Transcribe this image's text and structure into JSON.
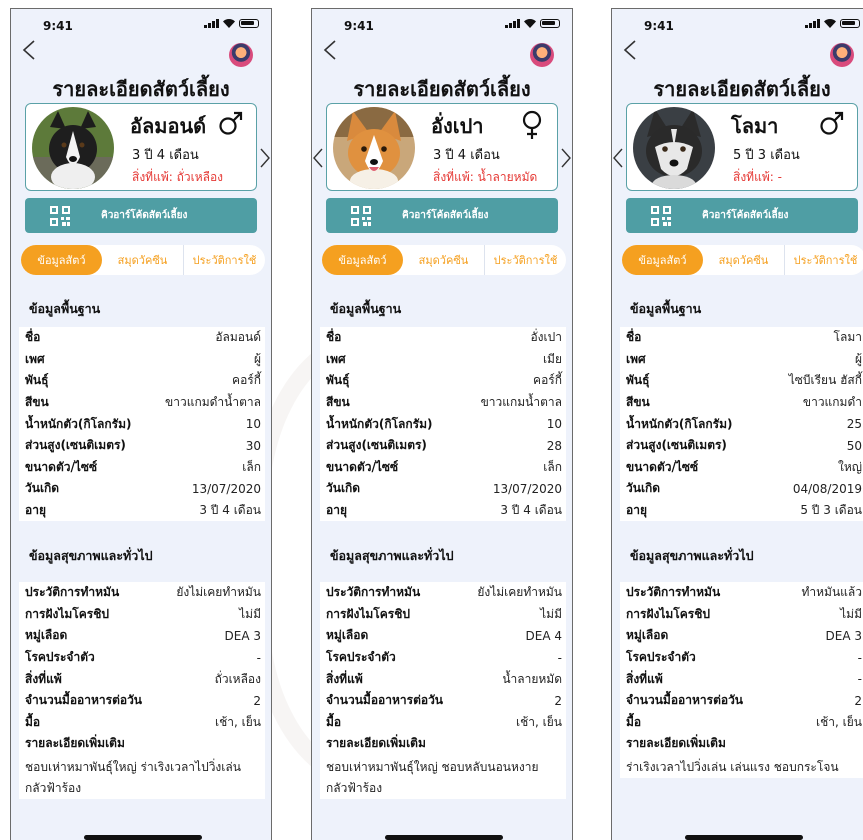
{
  "title": "รายละเอียดสัตว์เลี้ยง",
  "status_time": "9:41",
  "qr_label": "คิวอาร์โค้ดสัตว์เลี้ยง",
  "tabs": [
    "ข้อมูลสัตว์",
    "สมุดวัคซีน",
    "ประวัติการใช้"
  ],
  "section_basic": "ข้อมูลพื้นฐาน",
  "section_health": "ข้อมูลสุขภาพและทั่วไป",
  "colors": {
    "teal": "#4f9ea4",
    "orange": "#f5a020",
    "red": "#e53935",
    "bg": "#eef2fb"
  },
  "screens": [
    {
      "name": "อัลมอนด์",
      "gender_symbol": "♂",
      "age": "3 ปี 4 เดือน",
      "allergy": "สิ่งที่แพ้: ถั่วเหลือง",
      "basic": [
        {
          "k": "ชื่อ",
          "v": "อัลมอนด์"
        },
        {
          "k": "เพศ",
          "v": "ผู้"
        },
        {
          "k": "พันธุ์",
          "v": "คอร์กี้"
        },
        {
          "k": "สีขน",
          "v": "ขาวแกมดำน้ำตาล"
        },
        {
          "k": "น้ำหนักตัว(กิโลกรัม)",
          "v": "10"
        },
        {
          "k": "ส่วนสูง(เซนติเมตร)",
          "v": "30"
        },
        {
          "k": "ขนาดตัว/ไซซ์",
          "v": "เล็ก"
        },
        {
          "k": "วันเกิด",
          "v": "13/07/2020"
        },
        {
          "k": "อายุ",
          "v": "3 ปี 4 เดือน"
        }
      ],
      "health": [
        {
          "k": "ประวัติการทำหมัน",
          "v": "ยังไม่เคยทำหมัน"
        },
        {
          "k": "การฝังไมโครชิป",
          "v": "ไม่มี"
        },
        {
          "k": "หมู่เลือด",
          "v": "DEA 3"
        },
        {
          "k": "โรคประจำตัว",
          "v": "-"
        },
        {
          "k": "สิ่งที่แพ้",
          "v": "ถั่วเหลือง"
        },
        {
          "k": "จำนวนมื้ออาหารต่อวัน",
          "v": "2"
        },
        {
          "k": "มื้อ",
          "v": "เช้า, เย็น"
        },
        {
          "k": "รายละเอียดเพิ่มเติม",
          "v": ""
        }
      ],
      "extra": [
        "ชอบเห่าหมาพันธุ์ใหญ่ ร่าเริงเวลาไปวิ่งเล่น",
        "กลัวฟ้าร้อง"
      ]
    },
    {
      "name": "อั่งเปา",
      "gender_symbol": "♀",
      "age": "3 ปี 4 เดือน",
      "allergy": "สิ่งที่แพ้: น้ำลายหมัด",
      "basic": [
        {
          "k": "ชื่อ",
          "v": "อั่งเปา"
        },
        {
          "k": "เพศ",
          "v": "เมีย"
        },
        {
          "k": "พันธุ์",
          "v": "คอร์กี้"
        },
        {
          "k": "สีขน",
          "v": "ขาวแกมน้ำตาล"
        },
        {
          "k": "น้ำหนักตัว(กิโลกรัม)",
          "v": "10"
        },
        {
          "k": "ส่วนสูง(เซนติเมตร)",
          "v": "28"
        },
        {
          "k": "ขนาดตัว/ไซซ์",
          "v": "เล็ก"
        },
        {
          "k": "วันเกิด",
          "v": "13/07/2020"
        },
        {
          "k": "อายุ",
          "v": "3 ปี 4 เดือน"
        }
      ],
      "health": [
        {
          "k": "ประวัติการทำหมัน",
          "v": "ยังไม่เคยทำหมัน"
        },
        {
          "k": "การฝังไมโครชิป",
          "v": "ไม่มี"
        },
        {
          "k": "หมู่เลือด",
          "v": "DEA 4"
        },
        {
          "k": "โรคประจำตัว",
          "v": "-"
        },
        {
          "k": "สิ่งที่แพ้",
          "v": "น้ำลายหมัด"
        },
        {
          "k": "จำนวนมื้ออาหารต่อวัน",
          "v": "2"
        },
        {
          "k": "มื้อ",
          "v": "เช้า, เย็น"
        },
        {
          "k": "รายละเอียดเพิ่มเติม",
          "v": ""
        }
      ],
      "extra": [
        "ชอบเห่าหมาพันธุ์ใหญ่ ชอบหลับนอนหงาย",
        "กลัวฟ้าร้อง"
      ]
    },
    {
      "name": "โลมา",
      "gender_symbol": "♂",
      "age": "5 ปี 3 เดือน",
      "allergy": "สิ่งที่แพ้: -",
      "basic": [
        {
          "k": "ชื่อ",
          "v": "โลมา"
        },
        {
          "k": "เพศ",
          "v": "ผู้"
        },
        {
          "k": "พันธุ์",
          "v": "ไซบีเรียน ฮัสกี้"
        },
        {
          "k": "สีขน",
          "v": "ขาวแกมดำ"
        },
        {
          "k": "น้ำหนักตัว(กิโลกรัม)",
          "v": "25"
        },
        {
          "k": "ส่วนสูง(เซนติเมตร)",
          "v": "50"
        },
        {
          "k": "ขนาดตัว/ไซซ์",
          "v": "ใหญ่"
        },
        {
          "k": "วันเกิด",
          "v": "04/08/2019"
        },
        {
          "k": "อายุ",
          "v": "5 ปี 3 เดือน"
        }
      ],
      "health": [
        {
          "k": "ประวัติการทำหมัน",
          "v": "ทำหมันแล้ว"
        },
        {
          "k": "การฝังไมโครชิป",
          "v": "ไม่มี"
        },
        {
          "k": "หมู่เลือด",
          "v": "DEA 3"
        },
        {
          "k": "โรคประจำตัว",
          "v": "-"
        },
        {
          "k": "สิ่งที่แพ้",
          "v": "-"
        },
        {
          "k": "จำนวนมื้ออาหารต่อวัน",
          "v": "2"
        },
        {
          "k": "มื้อ",
          "v": "เช้า, เย็น"
        },
        {
          "k": "รายละเอียดเพิ่มเติม",
          "v": ""
        }
      ],
      "extra": [
        "ร่าเริงเวลาไปวิ่งเล่น เล่นแรง ชอบกระโจน"
      ]
    }
  ]
}
